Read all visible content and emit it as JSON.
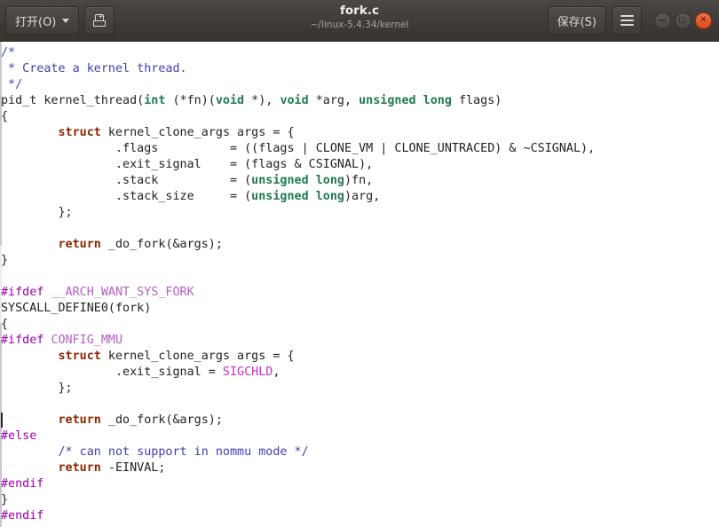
{
  "titlebar": {
    "open_label": "打开(O)",
    "open_icon": "chevron-down-icon",
    "saveas_icon": "save-as-icon",
    "title": "fork.c",
    "path": "~/linux-5.4.34/kernel",
    "save_label": "保存(S)",
    "menu_icon": "hamburger-menu-icon",
    "minimize_icon": "minimize-icon",
    "maximize_icon": "maximize-icon",
    "close_icon": "close-icon",
    "bg_color": "#3d3a37",
    "close_color": "#d8481c"
  },
  "editor": {
    "language": "c",
    "font_size_px": 13.4,
    "line_height_px": 18,
    "cursor": {
      "line": 23,
      "column": 0
    },
    "colors": {
      "background": "#ffffff",
      "foreground": "#222222",
      "comment": "#3f3fb0",
      "type_keyword": "#1f7a52",
      "control_keyword": "#8b2500",
      "preprocessor": "#9a00a8",
      "preprocessor_identifier": "#b45ec4",
      "macro_constant": "#d02ad0"
    },
    "lines": [
      [
        {
          "t": "/*",
          "c": "cmt"
        }
      ],
      [
        {
          "t": " * Create a kernel thread.",
          "c": "cmt"
        }
      ],
      [
        {
          "t": " */",
          "c": "cmt"
        }
      ],
      [
        {
          "t": "pid_t kernel_thread(",
          "c": ""
        },
        {
          "t": "int",
          "c": "kw"
        },
        {
          "t": " (*fn)(",
          "c": ""
        },
        {
          "t": "void",
          "c": "kw"
        },
        {
          "t": " *), ",
          "c": ""
        },
        {
          "t": "void",
          "c": "kw"
        },
        {
          "t": " *arg, ",
          "c": ""
        },
        {
          "t": "unsigned long",
          "c": "kw"
        },
        {
          "t": " flags)",
          "c": ""
        }
      ],
      [
        {
          "t": "{",
          "c": ""
        }
      ],
      [
        {
          "t": "        ",
          "c": ""
        },
        {
          "t": "struct",
          "c": "ctl"
        },
        {
          "t": " kernel_clone_args args = {",
          "c": ""
        }
      ],
      [
        {
          "t": "                .flags          = ((flags | CLONE_VM | CLONE_UNTRACED) & ~CSIGNAL),",
          "c": ""
        }
      ],
      [
        {
          "t": "                .exit_signal    = (flags & CSIGNAL),",
          "c": ""
        }
      ],
      [
        {
          "t": "                .stack          = (",
          "c": ""
        },
        {
          "t": "unsigned long",
          "c": "kw"
        },
        {
          "t": ")fn,",
          "c": ""
        }
      ],
      [
        {
          "t": "                .stack_size     = (",
          "c": ""
        },
        {
          "t": "unsigned long",
          "c": "kw"
        },
        {
          "t": ")arg,",
          "c": ""
        }
      ],
      [
        {
          "t": "        };",
          "c": ""
        }
      ],
      [
        {
          "t": "",
          "c": ""
        }
      ],
      [
        {
          "t": "        ",
          "c": ""
        },
        {
          "t": "return",
          "c": "ctl"
        },
        {
          "t": " _do_fork(&args);",
          "c": ""
        }
      ],
      [
        {
          "t": "}",
          "c": ""
        }
      ],
      [
        {
          "t": "",
          "c": ""
        }
      ],
      [
        {
          "t": "#ifdef",
          "c": "pp"
        },
        {
          "t": " ",
          "c": ""
        },
        {
          "t": "__ARCH_WANT_SYS_FORK",
          "c": "ppid"
        }
      ],
      [
        {
          "t": "SYSCALL_DEFINE0(fork)",
          "c": ""
        }
      ],
      [
        {
          "t": "{",
          "c": ""
        }
      ],
      [
        {
          "t": "#ifdef",
          "c": "pp"
        },
        {
          "t": " ",
          "c": ""
        },
        {
          "t": "CONFIG_MMU",
          "c": "ppid"
        }
      ],
      [
        {
          "t": "        ",
          "c": ""
        },
        {
          "t": "struct",
          "c": "ctl"
        },
        {
          "t": " kernel_clone_args args = {",
          "c": ""
        }
      ],
      [
        {
          "t": "                .exit_signal = ",
          "c": ""
        },
        {
          "t": "SIGCHLD",
          "c": "macro"
        },
        {
          "t": ",",
          "c": ""
        }
      ],
      [
        {
          "t": "        };",
          "c": ""
        }
      ],
      [
        {
          "t": "",
          "c": ""
        }
      ],
      [
        {
          "t": "        ",
          "c": ""
        },
        {
          "t": "return",
          "c": "ctl"
        },
        {
          "t": " _do_fork(&args);",
          "c": ""
        }
      ],
      [
        {
          "t": "#else",
          "c": "pp"
        }
      ],
      [
        {
          "t": "        ",
          "c": ""
        },
        {
          "t": "/* can not support in nommu mode */",
          "c": "cmt"
        }
      ],
      [
        {
          "t": "        ",
          "c": ""
        },
        {
          "t": "return",
          "c": "ctl"
        },
        {
          "t": " -EINVAL;",
          "c": ""
        }
      ],
      [
        {
          "t": "#endif",
          "c": "pp"
        }
      ],
      [
        {
          "t": "}",
          "c": ""
        }
      ],
      [
        {
          "t": "#endif",
          "c": "pp"
        }
      ]
    ]
  }
}
